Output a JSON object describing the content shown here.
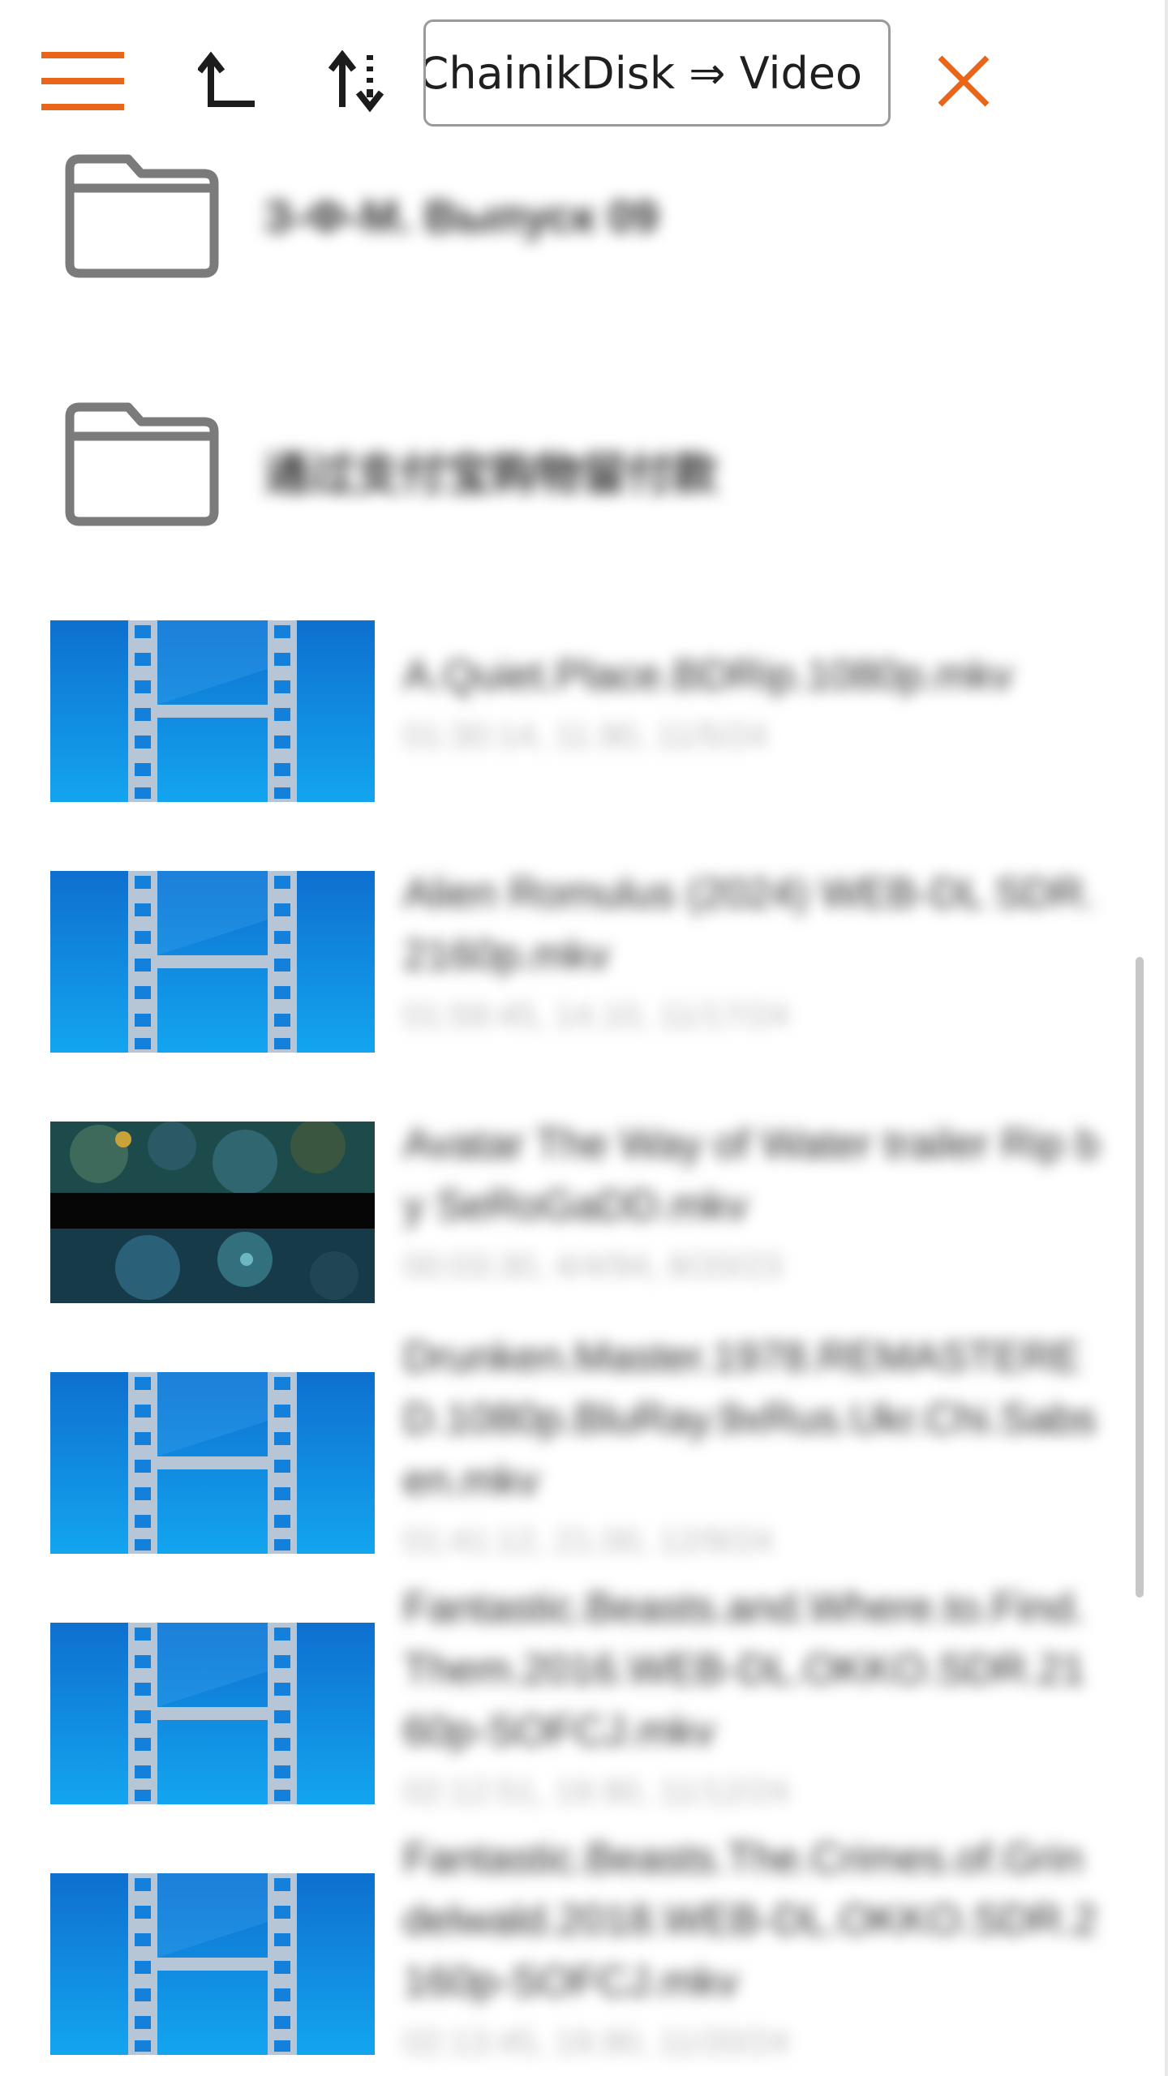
{
  "toolbar": {
    "menu_icon": "hamburger-menu-icon",
    "up_icon": "parent-folder-arrow-icon",
    "sort_icon": "sort-arrows-icon",
    "path_text": "ChainikDisk ⇒ Video",
    "close_icon": "close-x-icon"
  },
  "colors": {
    "accent": "#e8651a",
    "folder_stroke": "#7b7b7b",
    "thumb_blue": "#1a8fe0",
    "text_dark": "#2b2b2b",
    "text_meta": "#b9b9b9"
  },
  "folders": [
    {
      "name": "З-Ф-М. Выпуск 09"
    },
    {
      "name": "通过支付宝购物留付款"
    }
  ],
  "videos": [
    {
      "name": "A.Quiet.Place.BDRip.1080p.mkv",
      "meta": "01:30:14, 11.90, 11/5/24",
      "thumb": "film-strip"
    },
    {
      "name": "Alien Romulus (2024) WEB-DL SDR.2160p.mkv",
      "meta": "01:59:45, 14.10, 11/17/24",
      "thumb": "film-strip"
    },
    {
      "name": "Avatar The Way of Water trailer Rip by SeRoGaDD.mkv",
      "meta": "00:03:30, 4/4/94, 8/20/23",
      "thumb": "movie-frame"
    },
    {
      "name": "Drunken.Master.1978.REMASTERED.1080p.BluRay.9xRus.Ukr.Chi.Sabsen.mkv",
      "meta": "01:41:12, 21.00, 12/9/24",
      "thumb": "film-strip"
    },
    {
      "name": "Fantastic.Beasts.and.Where.to.Find.Them.2016.WEB-DL.OKKO.SDR.2160p-SOFCJ.mkv",
      "meta": "02:12:51, 19.90, 11/12/24",
      "thumb": "film-strip"
    },
    {
      "name": "Fantastic.Beasts.The.Crimes.of.Grindelwald.2018.WEB-DL.OKKO.SDR.2160p-SOFCJ.mkv",
      "meta": "02:13:45, 19.90, 11/20/24",
      "thumb": "film-strip"
    }
  ],
  "scroll_position": 0.45
}
